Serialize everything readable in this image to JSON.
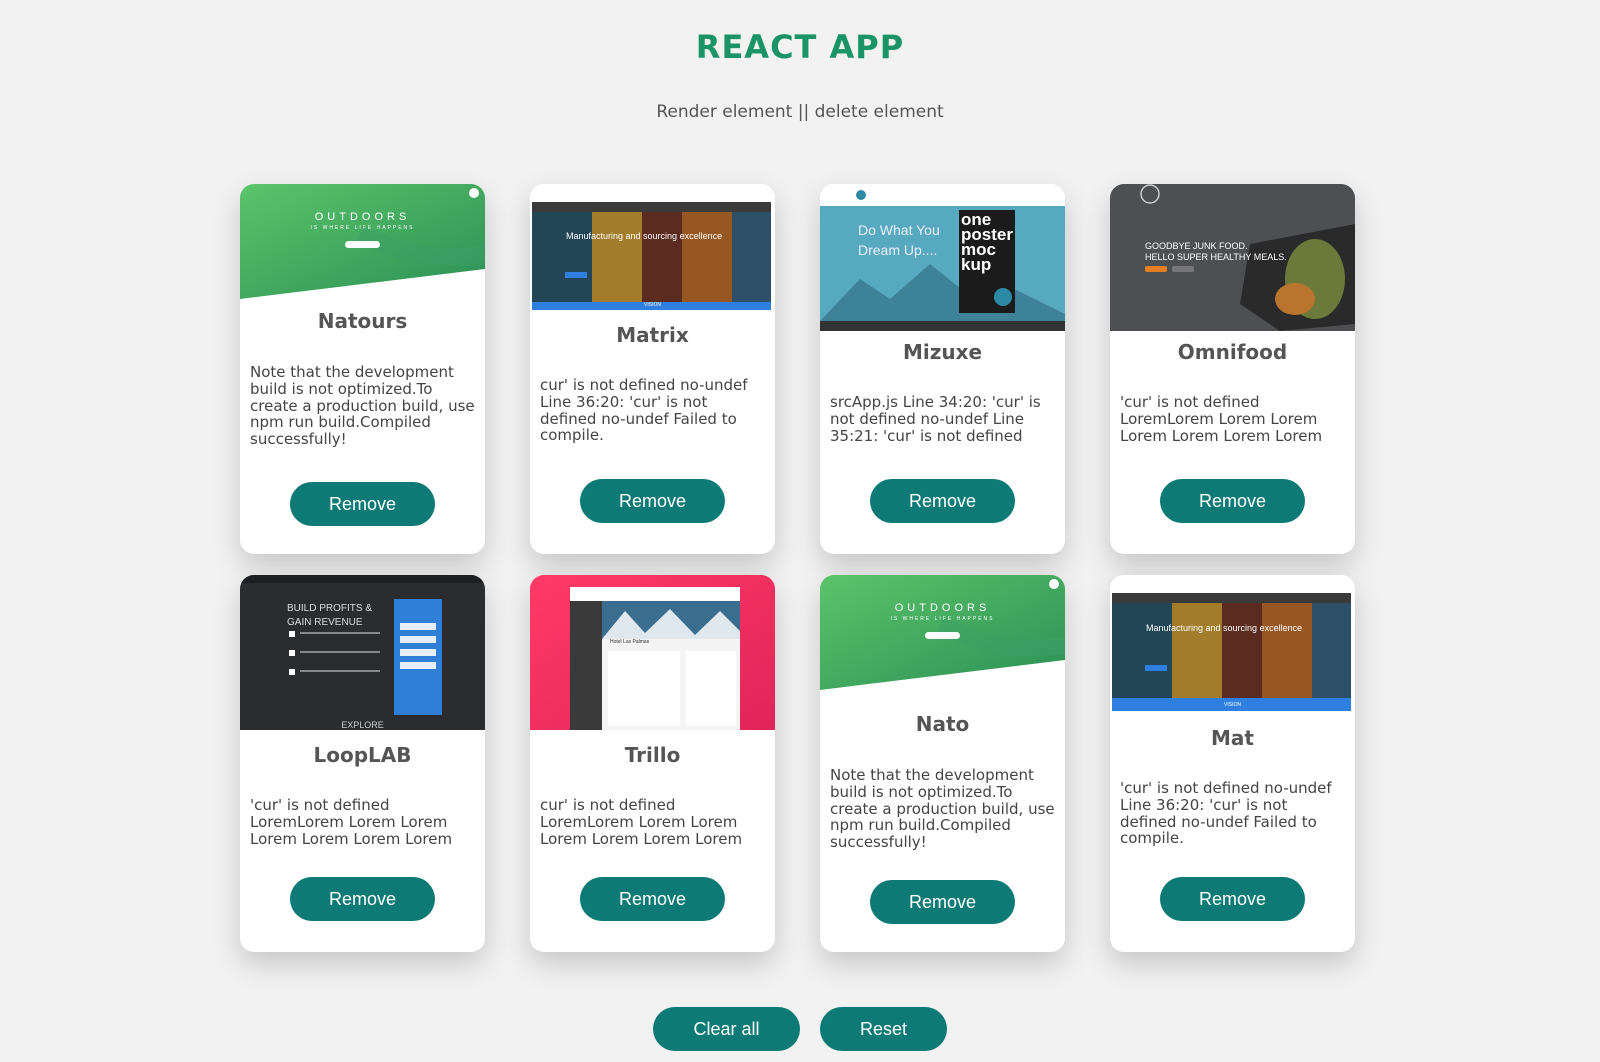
{
  "header": {
    "title": "REACT APP",
    "subtitle": "Render element || delete element"
  },
  "cards": [
    {
      "name": "Natours",
      "text": "Note that the development build is not optimized.To create a production build, use npm run build.Compiled successfully!",
      "button": "Remove",
      "thumb": {
        "line1": "OUTDOORS",
        "line2": "IS WHERE LIFE HAPPENS"
      }
    },
    {
      "name": "Matrix",
      "text": "cur' is not defined no-undef Line 36:20: 'cur' is not defined no-undef Failed to compile.",
      "button": "Remove",
      "thumb": {
        "line1": "Manufacturing and sourcing excellence",
        "line2": "VISION"
      }
    },
    {
      "name": "Mizuxe",
      "text": "srcApp.js Line 34:20: 'cur' is not defined no-undef Line 35:21: 'cur' is not defined",
      "button": "Remove",
      "thumb": {
        "line1": "Do What You Dream Up....",
        "line2": "one poster moc kup"
      }
    },
    {
      "name": "Omnifood",
      "text": "'cur' is not defined LoremLorem Lorem Lorem Lorem Lorem Lorem Lorem",
      "button": "Remove",
      "thumb": {
        "line1": "GOODBYE JUNK FOOD.",
        "line2": "HELLO SUPER HEALTHY MEALS."
      }
    },
    {
      "name": "LoopLAB",
      "text": "'cur' is not defined LoremLorem Lorem Lorem Lorem Lorem Lorem Lorem",
      "button": "Remove",
      "thumb": {
        "line1": "BUILD PROFITS & GAIN REVENUE",
        "line2": "EXPLORE"
      }
    },
    {
      "name": "Trillo",
      "text": "cur' is not defined LoremLorem Lorem Lorem Lorem Lorem Lorem Lorem",
      "button": "Remove",
      "thumb": {
        "line1": "Hotel Las Palmas",
        "line2": ""
      }
    },
    {
      "name": "Nato",
      "text": "Note that the development build is not optimized.To create a production build, use npm run build.Compiled successfully!",
      "button": "Remove",
      "thumb": {
        "line1": "OUTDOORS",
        "line2": "IS WHERE LIFE HAPPENS"
      }
    },
    {
      "name": "Mat",
      "text": "'cur' is not defined no-undef Line 36:20: 'cur' is not defined no-undef Failed to compile.",
      "button": "Remove",
      "thumb": {
        "line1": "Manufacturing and sourcing excellence",
        "line2": "VISION"
      }
    }
  ],
  "footer": {
    "clear_label": "Clear all",
    "reset_label": "Reset"
  },
  "colors": {
    "accent": "#0d7a75",
    "title": "#1a9466",
    "background": "#f2f2f2"
  }
}
